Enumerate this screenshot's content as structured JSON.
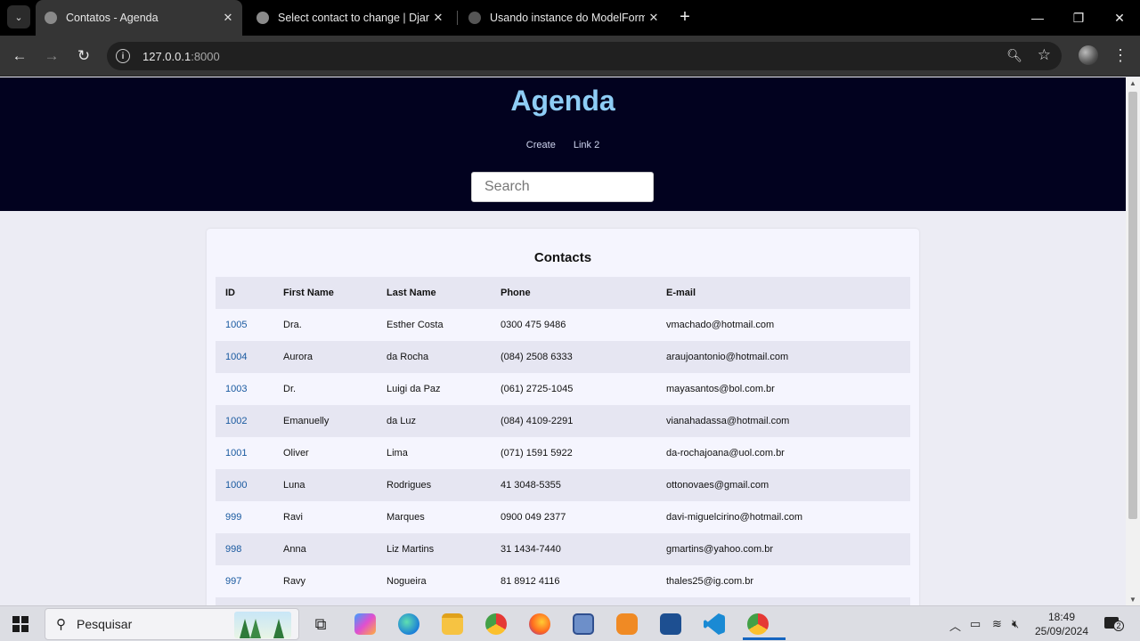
{
  "browser": {
    "tabs": [
      {
        "title": "Contatos - Agenda",
        "active": true
      },
      {
        "title": "Select contact to change | Djang",
        "active": false
      },
      {
        "title": "Usando instance do ModelForm",
        "active": false
      }
    ],
    "url_host": "127.0.0.1",
    "url_port": ":8000"
  },
  "site": {
    "title": "Agenda",
    "nav": [
      "Create",
      "Link 2"
    ],
    "search_placeholder": "Search"
  },
  "contacts": {
    "heading": "Contacts",
    "columns": [
      "ID",
      "First Name",
      "Last Name",
      "Phone",
      "E-mail"
    ],
    "rows": [
      [
        "1005",
        "Dra.",
        "Esther Costa",
        "0300 475 9486",
        "vmachado@hotmail.com"
      ],
      [
        "1004",
        "Aurora",
        "da Rocha",
        "(084) 2508 6333",
        "araujoantonio@hotmail.com"
      ],
      [
        "1003",
        "Dr.",
        "Luigi da Paz",
        "(061) 2725-1045",
        "mayasantos@bol.com.br"
      ],
      [
        "1002",
        "Emanuelly",
        "da Luz",
        "(084) 4109-2291",
        "vianahadassa@hotmail.com"
      ],
      [
        "1001",
        "Oliver",
        "Lima",
        "(071) 1591 5922",
        "da-rochajoana@uol.com.br"
      ],
      [
        "1000",
        "Luna",
        "Rodrigues",
        "41 3048-5355",
        "ottonovaes@gmail.com"
      ],
      [
        "999",
        "Ravi",
        "Marques",
        "0900 049 2377",
        "davi-miguelcirino@hotmail.com"
      ],
      [
        "998",
        "Anna",
        "Liz Martins",
        "31 1434-7440",
        "gmartins@yahoo.com.br"
      ],
      [
        "997",
        "Ravy",
        "Nogueira",
        "81 8912 4116",
        "thales25@ig.com.br"
      ]
    ]
  },
  "taskbar": {
    "search_placeholder": "Pesquisar",
    "time": "18:49",
    "date": "25/09/2024",
    "notification_count": "2"
  }
}
